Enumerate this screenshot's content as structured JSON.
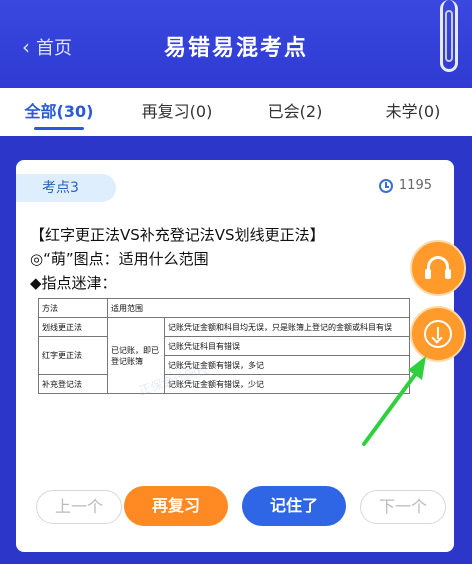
{
  "header": {
    "back_label": "首页",
    "title": "易错易混考点"
  },
  "tabs": [
    {
      "label": "全部(30)"
    },
    {
      "label": "再复习(0)"
    },
    {
      "label": "已会(2)"
    },
    {
      "label": "未学(0)"
    }
  ],
  "card": {
    "badge": "考点3",
    "views": "1195",
    "line1": "【红字更正法VS补充登记法VS划线更正法】",
    "line2": "◎“萌”图点：适用什么范围",
    "line3": "◆指点迷津：",
    "table": {
      "headers": [
        "方法",
        "适用范围",
        ""
      ],
      "rows": [
        [
          "划线更正法",
          "",
          "记账凭证金额和科目均无误，只是账簿上登记的金额或科目有误"
        ],
        [
          "红字更正法",
          "已记账，即已登记账簿",
          "记账凭证科目有错误"
        ],
        [
          "",
          "",
          "记账凭证金额有错误，多记"
        ],
        [
          "补充登记法",
          "",
          "记账凭证金额有错误，少记"
        ]
      ]
    },
    "watermark": "正保会计网校"
  },
  "buttons": {
    "prev": "上一个",
    "review": "再复习",
    "remember": "记住了",
    "next": "下一个"
  },
  "colors": {
    "background": "#2c37c9",
    "accent_orange": "#ff8a23",
    "accent_blue": "#2e66e6",
    "annotation_green": "#2fcf3e"
  }
}
